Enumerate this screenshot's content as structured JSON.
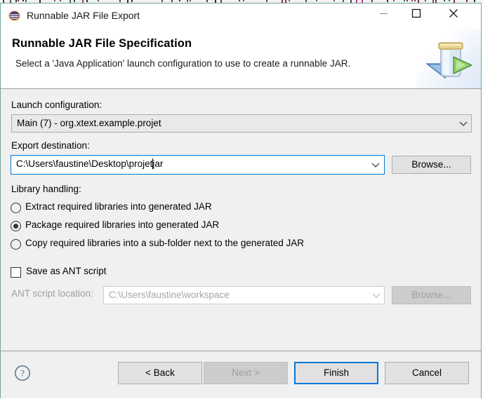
{
  "window": {
    "title": "Runnable JAR File Export",
    "icon": "eclipse-icon",
    "border_color": "#6fa79a",
    "controls": {
      "minimize": "minimize-icon",
      "maximize": "maximize-icon",
      "close": "close-icon"
    }
  },
  "header": {
    "title": "Runnable JAR File Specification",
    "description": "Select a 'Java Application' launch configuration to use to create a runnable JAR.",
    "banner_icon": "runnable-jar-icon"
  },
  "form": {
    "launch_configuration": {
      "label": "Launch configuration:",
      "value": "Main (7) - org.xtext.example.projet",
      "chevron": "chevron-down-icon"
    },
    "export_destination": {
      "label": "Export destination:",
      "value_before_caret": "C:\\Users\\faustine\\Desktop\\projet",
      "value_after_caret": "jar",
      "full_value": "C:\\Users\\faustine\\Desktop\\projet.jar",
      "browse_label": "Browse...",
      "chevron": "chevron-down-icon",
      "focus_color": "#0078d7"
    },
    "library_handling": {
      "label": "Library handling:",
      "options": [
        {
          "label": "Extract required libraries into generated JAR",
          "selected": false
        },
        {
          "label": "Package required libraries into generated JAR",
          "selected": true
        },
        {
          "label": "Copy required libraries into a sub-folder next to the generated JAR",
          "selected": false
        }
      ]
    },
    "ant_script": {
      "checkbox_label": "Save as ANT script",
      "checked": false,
      "location_label": "ANT script location:",
      "location_value": "C:\\Users\\faustine\\workspace",
      "location_disabled": true,
      "browse_label": "Browse...",
      "browse_disabled": true,
      "chevron": "chevron-down-icon"
    }
  },
  "footer": {
    "help_icon": "help-question-icon",
    "buttons": {
      "back": "< Back",
      "next": "Next >",
      "finish": "Finish",
      "cancel": "Cancel"
    },
    "next_disabled": true,
    "default_button": "Finish"
  }
}
